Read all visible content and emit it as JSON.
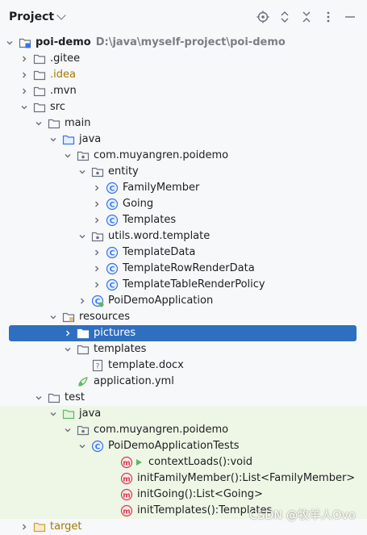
{
  "header": {
    "title": "Project"
  },
  "tree": [
    {
      "label": "poi-demo",
      "path": "D:\\java\\myself-project\\poi-demo",
      "icon": "module-folder-icon",
      "arrow": "down",
      "level": 0,
      "bold": true
    },
    {
      "label": ".gitee",
      "icon": "folder-icon",
      "arrow": "right",
      "level": 1
    },
    {
      "label": ".idea",
      "icon": "folder-icon",
      "arrow": "right",
      "level": 1,
      "style": "idea"
    },
    {
      "label": ".mvn",
      "icon": "folder-icon",
      "arrow": "right",
      "level": 1
    },
    {
      "label": "src",
      "icon": "folder-icon",
      "arrow": "down",
      "level": 1
    },
    {
      "label": "main",
      "icon": "folder-icon",
      "arrow": "down",
      "level": 2
    },
    {
      "label": "java",
      "icon": "source-folder-icon",
      "arrow": "down",
      "level": 3
    },
    {
      "label": "com.muyangren.poidemo",
      "icon": "package-icon",
      "arrow": "down",
      "level": 4
    },
    {
      "label": "entity",
      "icon": "package-icon",
      "arrow": "down",
      "level": 5
    },
    {
      "label": "FamilyMember",
      "icon": "class-icon",
      "arrow": "right",
      "level": 6
    },
    {
      "label": "Going",
      "icon": "class-icon",
      "arrow": "right",
      "level": 6
    },
    {
      "label": "Templates",
      "icon": "class-icon",
      "arrow": "right",
      "level": 6
    },
    {
      "label": "utils.word.template",
      "icon": "package-icon",
      "arrow": "down",
      "level": 5
    },
    {
      "label": "TemplateData",
      "icon": "class-icon",
      "arrow": "right",
      "level": 6
    },
    {
      "label": "TemplateRowRenderData",
      "icon": "class-icon",
      "arrow": "right",
      "level": 6
    },
    {
      "label": "TemplateTableRenderPolicy",
      "icon": "class-icon",
      "arrow": "right",
      "level": 6
    },
    {
      "label": "PoiDemoApplication",
      "icon": "spring-class-icon",
      "arrow": "right",
      "level": 5
    },
    {
      "label": "resources",
      "icon": "resources-folder-icon",
      "arrow": "down",
      "level": 3
    },
    {
      "label": "pictures",
      "icon": "folder-icon",
      "arrow": "right",
      "level": 4,
      "selected": true
    },
    {
      "label": "templates",
      "icon": "folder-icon",
      "arrow": "down",
      "level": 4
    },
    {
      "label": "template.docx",
      "icon": "unknown-file-icon",
      "arrow": "none",
      "level": 5
    },
    {
      "label": "application.yml",
      "icon": "yaml-file-icon",
      "arrow": "none",
      "level": 4
    },
    {
      "label": "test",
      "icon": "folder-icon",
      "arrow": "down",
      "level": 2
    },
    {
      "label": "java",
      "icon": "test-source-folder-icon",
      "arrow": "down",
      "level": 3,
      "test": true
    },
    {
      "label": "com.muyangren.poidemo",
      "icon": "package-icon",
      "arrow": "down",
      "level": 4,
      "test": true
    },
    {
      "label": "PoiDemoApplicationTests",
      "icon": "class-icon",
      "arrow": "down",
      "level": 5,
      "test": true
    },
    {
      "label": "contextLoads():void",
      "icon": "method-icon",
      "arrow": "none",
      "level": 7,
      "test": true,
      "run": true
    },
    {
      "label": "initFamilyMember():List<FamilyMember>",
      "icon": "method-icon",
      "arrow": "none",
      "level": 7,
      "test": true
    },
    {
      "label": "initGoing():List<Going>",
      "icon": "method-icon",
      "arrow": "none",
      "level": 7,
      "test": true
    },
    {
      "label": "initTemplates():Templates",
      "icon": "method-icon",
      "arrow": "none",
      "level": 7,
      "test": true
    },
    {
      "label": "target",
      "icon": "excluded-folder-icon",
      "arrow": "right",
      "level": 1,
      "style": "target"
    }
  ],
  "watermark": "CSDN @牧羊人Ovo"
}
